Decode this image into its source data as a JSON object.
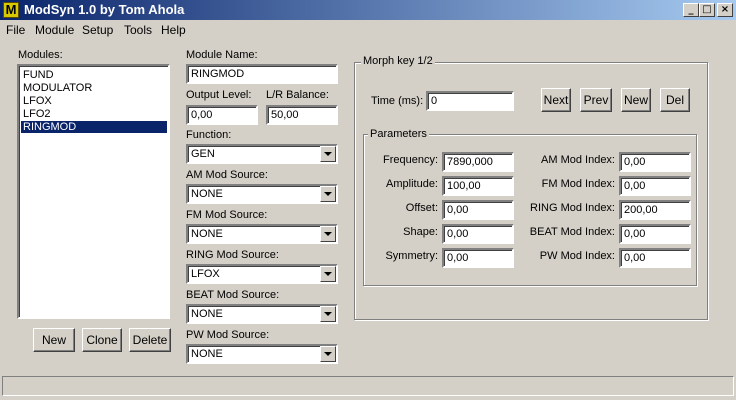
{
  "window": {
    "title": "ModSyn 1.0 by Tom Ahola",
    "icon_letter": "M"
  },
  "menu": [
    "File",
    "Module",
    "Setup",
    "Tools",
    "Help"
  ],
  "modules": {
    "label": "Modules:",
    "items": [
      "FUND",
      "MODULATOR",
      "LFOX",
      "LFO2",
      "RINGMOD"
    ],
    "selected": "RINGMOD",
    "buttons": {
      "new": "New",
      "clone": "Clone",
      "delete": "Delete"
    }
  },
  "module": {
    "name_label": "Module Name:",
    "name_value": "RINGMOD",
    "output_label": "Output Level:",
    "output_value": "0,00",
    "balance_label": "L/R Balance:",
    "balance_value": "50,00",
    "function_label": "Function:",
    "function_value": "GEN",
    "am_label": "AM Mod Source:",
    "am_value": "NONE",
    "fm_label": "FM Mod Source:",
    "fm_value": "NONE",
    "ring_label": "RING Mod Source:",
    "ring_value": "LFOX",
    "beat_label": "BEAT Mod Source:",
    "beat_value": "NONE",
    "pw_label": "PW Mod Source:",
    "pw_value": "NONE"
  },
  "morph": {
    "title": "Morph key 1/2",
    "time_label": "Time (ms):",
    "time_value": "0",
    "buttons": {
      "next": "Next",
      "prev": "Prev",
      "new": "New",
      "del": "Del"
    },
    "params_title": "Parameters",
    "left": {
      "frequency_label": "Frequency:",
      "frequency_value": "7890,000",
      "amplitude_label": "Amplitude:",
      "amplitude_value": "100,00",
      "offset_label": "Offset:",
      "offset_value": "0,00",
      "shape_label": "Shape:",
      "shape_value": "0,00",
      "symmetry_label": "Symmetry:",
      "symmetry_value": "0,00"
    },
    "right": {
      "am_label": "AM Mod Index:",
      "am_value": "0,00",
      "fm_label": "FM Mod Index:",
      "fm_value": "0,00",
      "ring_label": "RING Mod Index:",
      "ring_value": "200,00",
      "beat_label": "BEAT Mod Index:",
      "beat_value": "0,00",
      "pw_label": "PW Mod Index:",
      "pw_value": "0,00"
    }
  },
  "status": {
    "text": ""
  }
}
